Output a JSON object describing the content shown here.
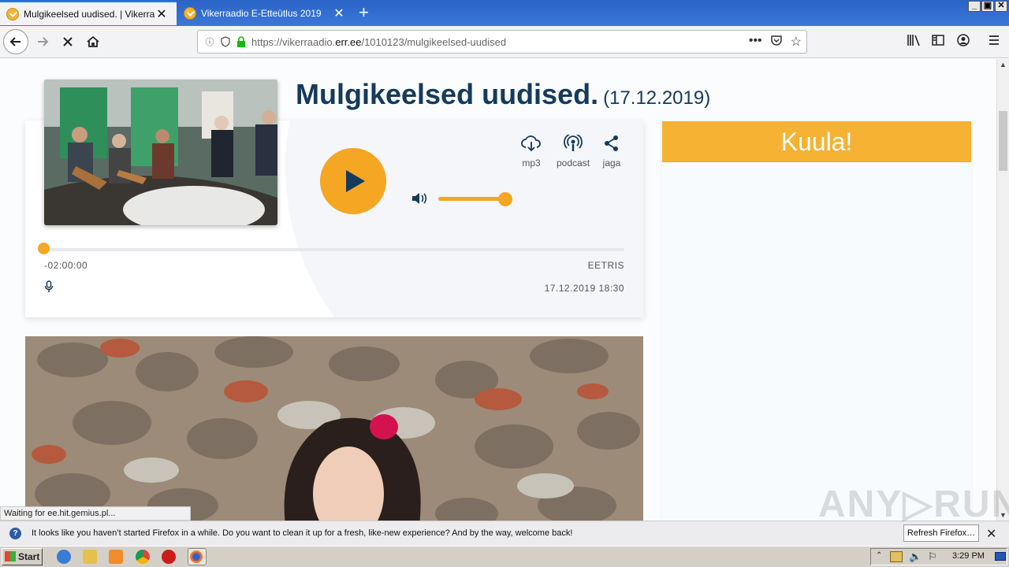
{
  "browser": {
    "tabs": [
      {
        "title": "Mulgikeelsed uudised. | Vikerraadio",
        "close": "✕"
      },
      {
        "title": "Vikerraadio E-Etteütlus 2019",
        "close": "✕"
      }
    ],
    "new_tab": "+",
    "url_host_prefix": "https://vikerraadio.",
    "url_host": "err.ee",
    "url_path": "/1010123/mulgikeelsed-uudised",
    "status_tip": "Waiting for ee.hit.gemius.pl..."
  },
  "page": {
    "title": "Mulgikeelsed uudised.",
    "title_date": "(17.12.2019)",
    "player": {
      "actions": [
        {
          "icon": "download-cloud-icon",
          "label": "mp3"
        },
        {
          "icon": "podcast-icon",
          "label": "podcast"
        },
        {
          "icon": "share-icon",
          "label": "jaga"
        }
      ],
      "volume_level": 0.9,
      "progress_level": 0.0,
      "time_remaining": "-02:00:00",
      "status": "EETRIS",
      "air_date": "17.12.2019 18:30"
    },
    "sidebar": {
      "header": "Kuula!"
    }
  },
  "notification": {
    "message": "It looks like you haven’t started Firefox in a while. Do you want to clean it up for a fresh, like-new experience? And by the way, welcome back!",
    "button": "Refresh Firefox…",
    "close": "✕"
  },
  "taskbar": {
    "start": "Start",
    "clock": "3:29 PM"
  },
  "colors": {
    "accent": "#f5a623",
    "title": "#153a5c"
  }
}
